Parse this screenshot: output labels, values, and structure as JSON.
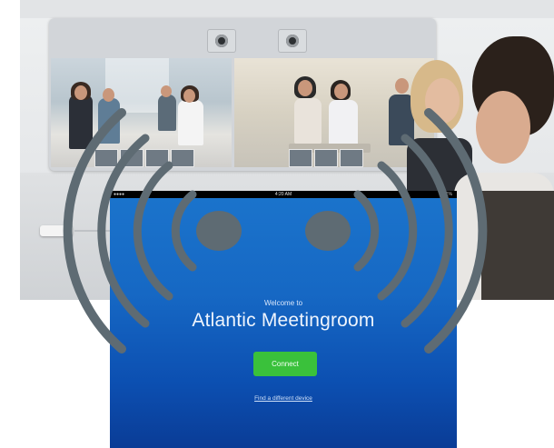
{
  "tablet": {
    "status_time": "4:20 AM",
    "status_battery": "81%",
    "status_signal": "●●●●",
    "welcome": "Welcome to",
    "device_name": "Atlantic Meetingroom",
    "connect_label": "Connect",
    "find_label": "Find a different device"
  },
  "icons": {
    "left_signal": "signal-waves-icon",
    "right_signal": "signal-waves-icon",
    "camera": "camera-icon"
  },
  "colors": {
    "tablet_top": "#1b74cc",
    "tablet_bottom": "#0a3c96",
    "connect_button": "#3ac13b",
    "signal_waves": "#5e6b73"
  }
}
